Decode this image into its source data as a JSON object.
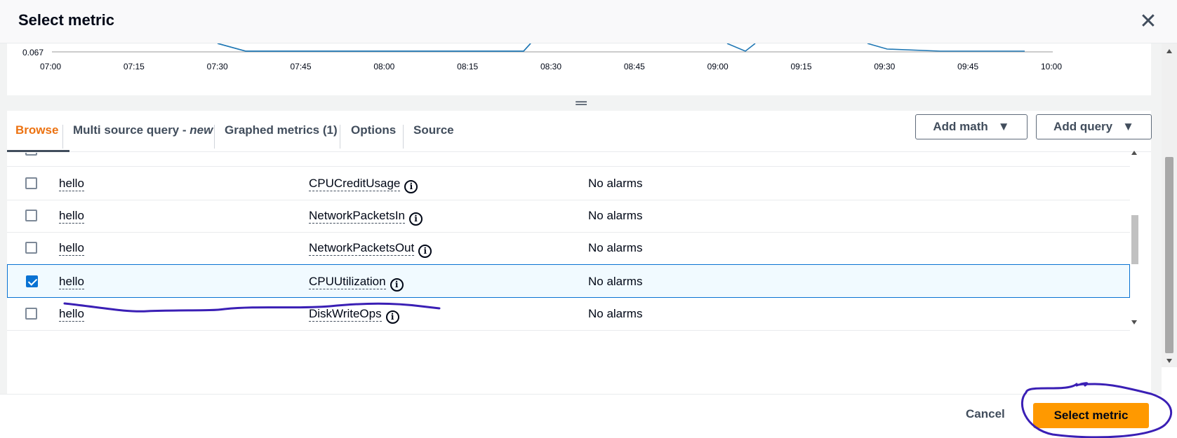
{
  "header": {
    "title": "Select metric",
    "close_icon": "close-icon"
  },
  "chart": {
    "y_tick": "0.067",
    "x_ticks": [
      "07:00",
      "07:15",
      "07:30",
      "07:45",
      "08:00",
      "08:15",
      "08:30",
      "08:45",
      "09:00",
      "09:15",
      "09:30",
      "09:45",
      "10:00"
    ],
    "line_color": "#1f77b4"
  },
  "tabs": {
    "browse": "Browse",
    "multi_source": "Multi source query - ",
    "multi_source_new": "new",
    "graphed": "Graphed metrics (1)",
    "options": "Options",
    "source": "Source"
  },
  "buttons": {
    "add_math": "Add math",
    "add_query": "Add query"
  },
  "table": {
    "rows": [
      {
        "instance": "hello",
        "metric": "CPUCreditUsage",
        "alarms": "No alarms",
        "checked": false
      },
      {
        "instance": "hello",
        "metric": "NetworkPacketsIn",
        "alarms": "No alarms",
        "checked": false
      },
      {
        "instance": "hello",
        "metric": "NetworkPacketsOut",
        "alarms": "No alarms",
        "checked": false
      },
      {
        "instance": "hello",
        "metric": "CPUUtilization",
        "alarms": "No alarms",
        "checked": true
      },
      {
        "instance": "hello",
        "metric": "DiskWriteOps",
        "alarms": "No alarms",
        "checked": false
      }
    ]
  },
  "footer": {
    "cancel": "Cancel",
    "select": "Select metric"
  },
  "colors": {
    "accent": "#ec7211",
    "primary": "#ff9900",
    "selected_border": "#0972d3",
    "annotation": "#3a1fb5"
  }
}
